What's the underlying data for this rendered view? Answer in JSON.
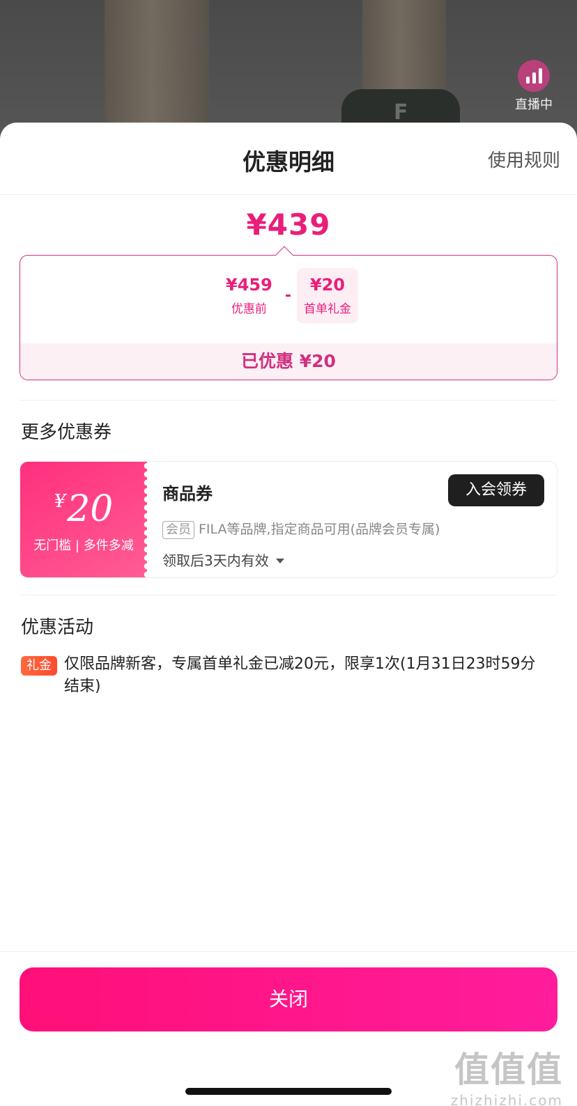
{
  "backdrop": {
    "brand_logo": "F",
    "live_badge": "直播中"
  },
  "sheet": {
    "title": "优惠明细",
    "rules_link": "使用规则"
  },
  "price": {
    "final": "¥439",
    "original_amount": "¥459",
    "original_label": "优惠前",
    "operator": "-",
    "discount_amount": "¥20",
    "discount_label": "首单礼金",
    "saved_text": "已优惠 ¥20"
  },
  "more_coupons": {
    "title": "更多优惠券",
    "coupon": {
      "currency": "¥",
      "amount": "20",
      "conditions": "无门槛 | 多件多减",
      "name": "商品券",
      "button": "入会领券",
      "member_tag": "会员",
      "description": "FILA等品牌,指定商品可用(品牌会员专属)",
      "validity": "领取后3天内有效"
    }
  },
  "promotions": {
    "title": "优惠活动",
    "items": [
      {
        "tag": "礼金",
        "text": "仅限品牌新客，专属首单礼金已减20元，限享1次(1月31日23时59分结束)"
      }
    ]
  },
  "footer": {
    "close_button": "关闭"
  },
  "watermark": {
    "mark": "值值值",
    "url": "zhizhizhi.com"
  },
  "colors": {
    "accent": "#e91e7a",
    "button_gradient_start": "#ff0f78",
    "button_gradient_end": "#ff1d9c",
    "coupon_gradient_start": "#ff2f7d",
    "promo_tag": "#ff5a35"
  }
}
